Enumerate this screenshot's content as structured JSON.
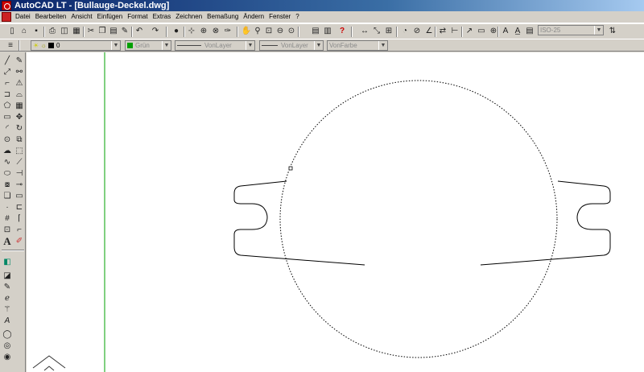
{
  "window": {
    "title": "AutoCAD LT - [Bullauge-Deckel.dwg]"
  },
  "menu": {
    "items": [
      "Datei",
      "Bearbeiten",
      "Ansicht",
      "Einfügen",
      "Format",
      "Extras",
      "Zeichnen",
      "Bemaßung",
      "Ändern",
      "Fenster",
      "?"
    ]
  },
  "toolbar": {
    "dimstyle": "ISO-25"
  },
  "properties": {
    "layer": "0",
    "color": "Grün",
    "color_hex": "#00a000",
    "linetype": "VonLayer",
    "lineweight": "VonLayer",
    "plotstyle": "VonFarbe"
  },
  "icons": {
    "standard_toolbar": [
      "new-icon",
      "open-icon",
      "save-icon",
      "print-icon",
      "preview-icon",
      "plot-icon",
      "cut-icon",
      "copy-icon",
      "paste-icon",
      "matchprop-icon",
      "undo-icon",
      "redo-icon",
      "cadcenter-icon",
      "pan-icon",
      "zoom-realtime-icon",
      "zoom-window-icon",
      "zoom-previous-icon",
      "aerial-view-icon",
      "properties-icon",
      "designcenter-icon",
      "help-icon"
    ],
    "dimension_toolbar": [
      "linear-dim-icon",
      "aligned-dim-icon",
      "ordinate-dim-icon",
      "radius-dim-icon",
      "diameter-dim-icon",
      "angular-dim-icon",
      "quick-dim-icon",
      "baseline-dim-icon",
      "continue-dim-icon",
      "leader-icon",
      "tolerance-icon",
      "center-mark-icon",
      "dimedit-icon",
      "dimtedit-icon",
      "dimstyle-icon"
    ],
    "draw_toolbar": [
      "line-icon",
      "construction-line-icon",
      "polyline-icon",
      "polygon-icon",
      "rectangle-icon",
      "arc-icon",
      "circle-icon",
      "revision-cloud-icon",
      "spline-icon",
      "ellipse-icon",
      "insert-block-icon",
      "make-block-icon",
      "point-icon",
      "hatch-icon",
      "region-icon",
      "text-icon"
    ],
    "modify_toolbar": [
      "erase-icon",
      "copy-object-icon",
      "mirror-icon",
      "offset-icon",
      "array-icon",
      "move-icon",
      "rotate-icon",
      "scale-icon",
      "stretch-icon",
      "lengthen-icon",
      "trim-icon",
      "extend-icon",
      "break-icon",
      "chamfer-icon",
      "fillet-icon",
      "explode-icon"
    ],
    "misc_toolbar": [
      "draworder-icon",
      "edit-icon",
      "properties-edit-icon",
      "match-icon",
      "attribute-icon",
      "text-edit-icon",
      "osnap-icon",
      "osnap2-icon",
      "osnap3-icon"
    ]
  }
}
